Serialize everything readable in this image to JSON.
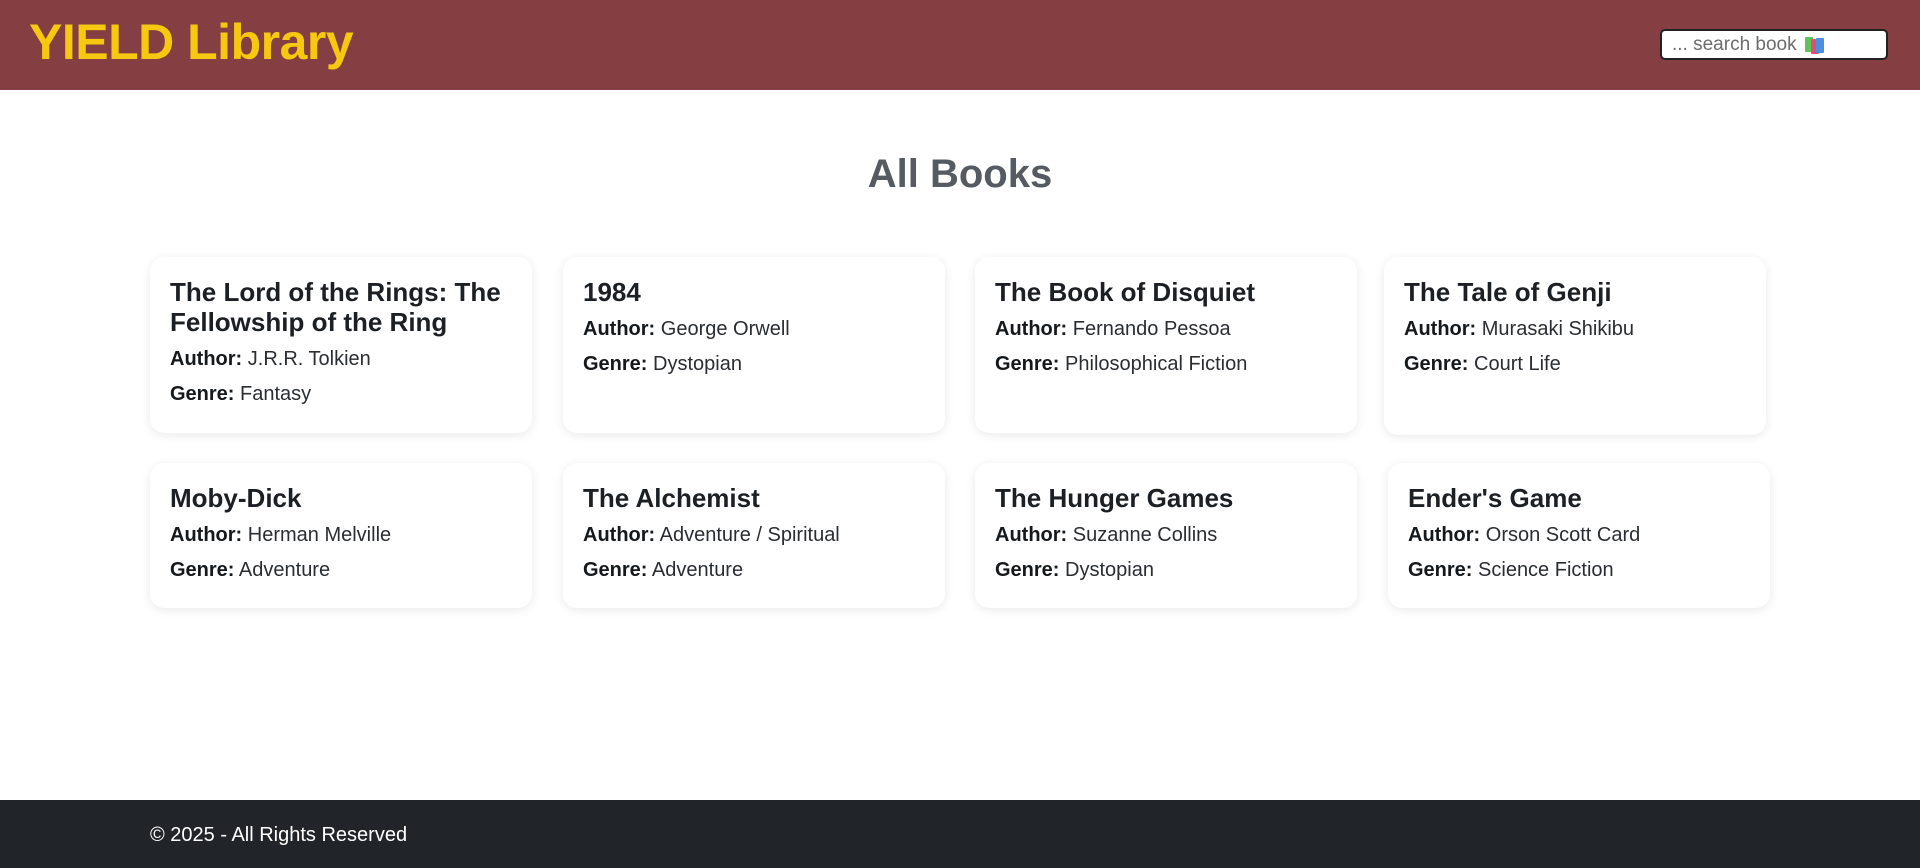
{
  "header": {
    "brand": "YIELD Library",
    "search_placeholder": "... search book",
    "search_icon": "books-icon"
  },
  "main": {
    "title": "All Books",
    "author_label": "Author:",
    "genre_label": "Genre:",
    "books": [
      {
        "title": "The Lord of the Rings: The Fellowship of the Ring",
        "author": "J.R.R. Tolkien",
        "genre": "Fantasy"
      },
      {
        "title": "1984",
        "author": "George Orwell",
        "genre": "Dystopian"
      },
      {
        "title": "The Book of Disquiet",
        "author": "Fernando Pessoa",
        "genre": "Philosophical Fiction"
      },
      {
        "title": "The Tale of Genji",
        "author": "Murasaki Shikibu",
        "genre": "Court Life"
      },
      {
        "title": "Moby-Dick",
        "author": "Herman Melville",
        "genre": "Adventure"
      },
      {
        "title": "The Alchemist",
        "author": "Adventure / Spiritual",
        "genre": "Adventure"
      },
      {
        "title": "The Hunger Games",
        "author": "Suzanne Collins",
        "genre": "Dystopian"
      },
      {
        "title": "Ender's Game",
        "author": "Orson Scott Card",
        "genre": "Science Fiction"
      }
    ]
  },
  "footer": {
    "text": "© 2025 - All Rights Reserved"
  },
  "colors": {
    "header_bg": "#853f42",
    "brand": "#f6c80f",
    "footer_bg": "#212529"
  }
}
